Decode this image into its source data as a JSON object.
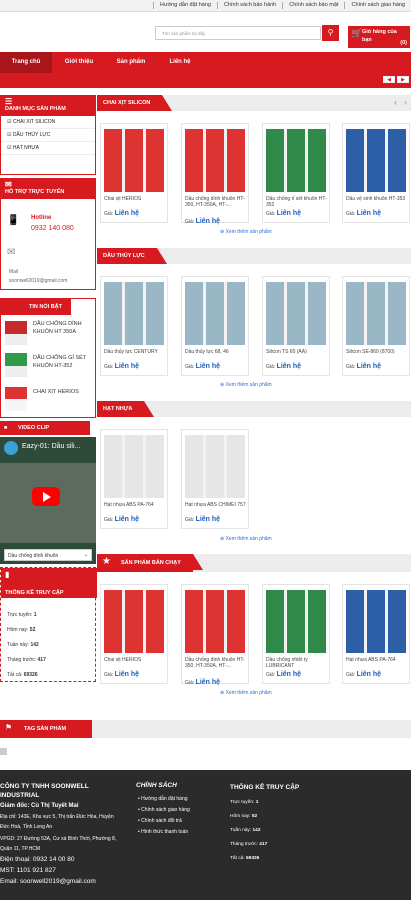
{
  "top_links": [
    "Hướng dẫn đặt hàng",
    "Chính sách bảo hành",
    "Chính sách bảo mật",
    "Chính sách giao hàng"
  ],
  "search": {
    "placeholder": "Tìm sản phẩm tại đây"
  },
  "cart": {
    "label": "Giỏ hàng của bạn",
    "count": "(0)"
  },
  "nav": [
    "Trang chủ",
    "Giới thiệu",
    "Sản phẩm",
    "Liên hệ"
  ],
  "sidebar": {
    "categories_title": "DANH MỤC SẢN PHẨM",
    "categories": [
      "CHAI XỊT SILICON",
      "DẦU THỦY LỰC",
      "HẠT NHỰA"
    ],
    "support_title": "HỖ TRỢ TRỰC TUYẾN",
    "hotline_label": "Hotline",
    "hotline": "0932 140 080",
    "mail_label": "Mail",
    "mail": "soonwell2019@gmail.com",
    "news_title": "TIN NỔI BẬT",
    "news": [
      "DẦU CHỐNG DÍNH KHUÔN HT 350A",
      "DẦU CHỐNG GỈ SÉT KHUÔN HT-352",
      "CHAI XỊT HERIOS"
    ],
    "video_title": "VIDEO CLIP",
    "video_caption": "Eazy-01: Dầu sili...",
    "video_select": "Dầu chống dính khuôn",
    "stats_title": "THỐNG KÊ TRUY CẬP",
    "stats": [
      [
        "Trực tuyến:",
        "1"
      ],
      [
        "Hôm nay:",
        "52"
      ],
      [
        "Tuần này:",
        "142"
      ],
      [
        "Tháng trước:",
        "417"
      ],
      [
        "Tất cả:",
        "69326"
      ]
    ]
  },
  "price_label": "Giá:",
  "price_value": "Liên hệ",
  "view_more": "Xem thêm sản phẩm",
  "sections": [
    {
      "title": "CHAI XỊT SILICON",
      "products": [
        "Chai xịt HERIOS",
        "Dầu chống dính khuôn HT-350, HT-350A, HT-...",
        "Dầu chống rỉ sét khuôn HT-352",
        "Dầu vệ sinh khuôn HT-353"
      ]
    },
    {
      "title": "DẦU THỦY LỰC",
      "products": [
        "Dầu thủy lực CENTURY",
        "Dầu thủy lực 68, 46",
        "Silicon TS 60 (AA)",
        "Silicon SE-860 (8700)"
      ]
    },
    {
      "title": "HẠT NHỰA",
      "products": [
        "Hạt nhựa ABS PA-764",
        "Hạt nhựa ABS CHIMEI 757"
      ]
    },
    {
      "title": "SẢN PHẨM BÁN CHẠY",
      "products": [
        "Chai xịt HERIOS",
        "Dầu chống dính khuôn HT-350, HT-350A, HT-...",
        "Dầu chống nhiệt ty LUBRICANT",
        "Hạt nhựa ABS PA-764"
      ]
    }
  ],
  "tags_title": "TAG SẢN PHẨM",
  "footer": {
    "company": "CÔNG TY TNHH SOONWELL INDUSTRIAL",
    "director": "Giám đốc: Cù Thị Tuyết Mai",
    "address": "Địa chỉ: 143E, Khu vực 5, Thị trấn Đức Hòa, Huyện Đức Hoà, Tỉnh Long An",
    "office": "VPGD: 27 Đường 53A, Cư xá Bình Thới, Phường 8, Quận 11, TP.HCM",
    "phone": "Điện thoại: 0932 14 00 80",
    "tax": "MST: 1101 921 827",
    "email": "Email: soonwell2019@gmail.com",
    "policy_title": "CHÍNH SÁCH",
    "policies": [
      "Hướng dẫn đặt hàng",
      "Chính sách giao hàng",
      "Chính sách đổi trả",
      "Hình thức thanh toán"
    ],
    "stats_title": "THỐNG KÊ TRUY CẬP",
    "stats": [
      [
        "Trực tuyến:",
        "1"
      ],
      [
        "Hôm nay:",
        "52"
      ],
      [
        "Tuần này:",
        "142"
      ],
      [
        "Tháng trước:",
        "417"
      ],
      [
        "Tất cả:",
        "69326"
      ]
    ]
  }
}
